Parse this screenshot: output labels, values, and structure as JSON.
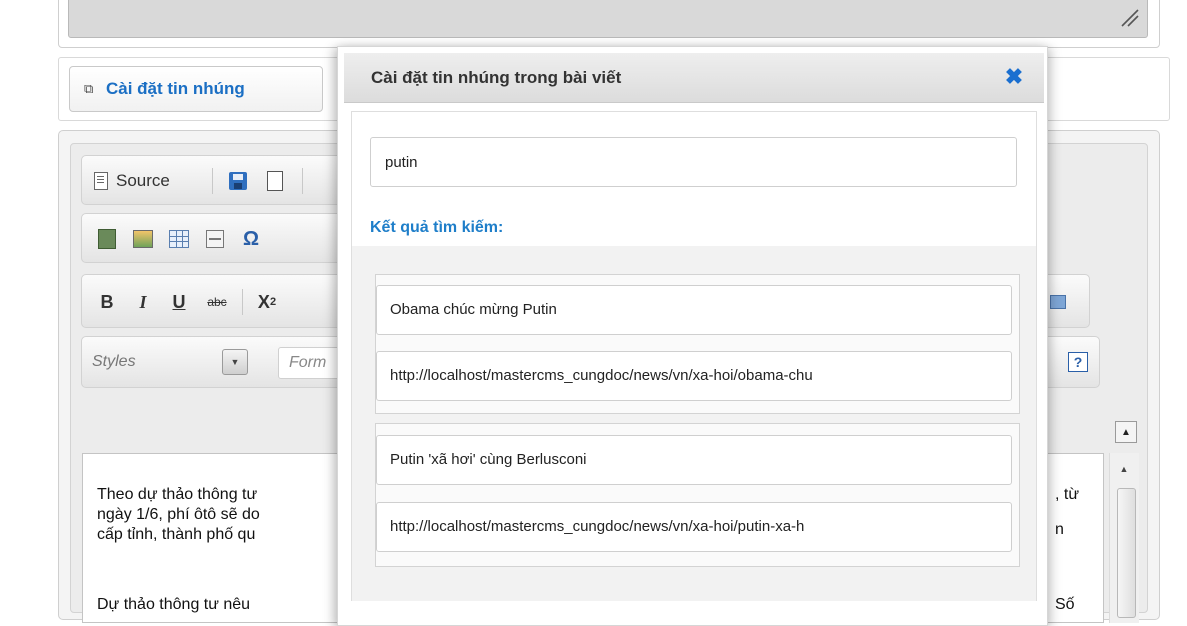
{
  "embed_button": {
    "label": "Cài đặt tin nhúng",
    "icon": "embed-copy-icon"
  },
  "toolbar": {
    "source_label": "Source",
    "styles_placeholder": "Styles",
    "format_placeholder": "Form",
    "bold_label": "B",
    "italic_label": "I",
    "underline_label": "U",
    "strike_label": "abc",
    "subscript_label": "X",
    "subscript_sub": "2",
    "help_label": "?"
  },
  "content": {
    "lines": [
      "Theo dự thảo thông tư",
      "ngày 1/6, phí ôtô sẽ do",
      "cấp tỉnh, thành phố qu",
      "Dự thảo thông tư nêu"
    ],
    "right_fragments": [
      ", từ",
      "n",
      "Số"
    ]
  },
  "modal": {
    "title": "Cài đặt tin nhúng trong bài viết",
    "search_value": "putin",
    "results_label": "Kết quả tìm kiếm:",
    "results": [
      {
        "title": "Obama chúc mừng Putin",
        "url": "http://localhost/mastercms_cungdoc/news/vn/xa-hoi/obama-chu"
      },
      {
        "title": "Putin 'xã hơi' cùng Berlusconi",
        "url": "http://localhost/mastercms_cungdoc/news/vn/xa-hoi/putin-xa-h"
      }
    ]
  },
  "colors": {
    "accent": "#1b6fc4",
    "close": "#1a6fd0",
    "results_label": "#1e7ec9"
  }
}
